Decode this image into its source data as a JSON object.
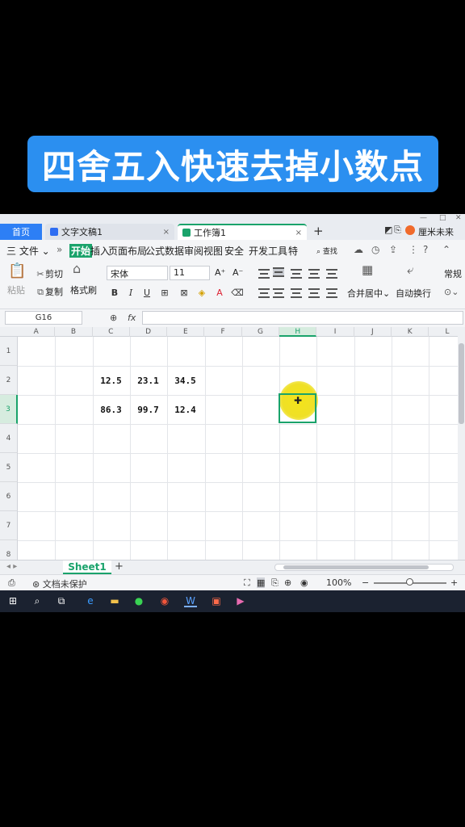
{
  "banner": {
    "title": "四舍五入快速去掉小数点"
  },
  "tabs": {
    "home": "首页",
    "doc": "文字文稿1",
    "sheet": "工作簿1",
    "close": "×",
    "plus": "+"
  },
  "user": {
    "name": "厘米未来"
  },
  "menu": {
    "file": "三 文件 ⌄",
    "more": "»",
    "items": [
      "开始",
      "插入",
      "页面布局",
      "公式",
      "数据",
      "审阅",
      "视图",
      "安全",
      "开发工具",
      "特"
    ],
    "search": "查找"
  },
  "ribbon": {
    "paste": "粘贴",
    "cut": "剪切",
    "copy": "复制",
    "format_painter": "格式刷",
    "font_name": "宋体",
    "font_size": "11",
    "grow": "A⁺",
    "shrink": "A⁻",
    "bold": "B",
    "italic": "I",
    "underline": "U",
    "merge": "合并居中",
    "wrap": "自动换行",
    "normal": "常规"
  },
  "formula_bar": {
    "cell_ref": "G16",
    "fx": "fx",
    "value": ""
  },
  "grid": {
    "columns": [
      "A",
      "B",
      "C",
      "D",
      "E",
      "F",
      "G",
      "H",
      "I",
      "J",
      "K",
      "L"
    ],
    "rows": [
      "1",
      "2",
      "3",
      "4",
      "5",
      "6",
      "7",
      "8"
    ],
    "selected_column": "H",
    "selected_row": "3",
    "values": {
      "r2": [
        "12.5",
        "23.1",
        "34.5"
      ],
      "r3": [
        "86.3",
        "99.7",
        "12.4"
      ]
    }
  },
  "sheet_tabs": {
    "active": "Sheet1",
    "add": "+"
  },
  "status": {
    "protect": "文档未保护",
    "zoom": "100%",
    "minus": "−",
    "plus": "+"
  },
  "colors": {
    "accent": "#1aa36b",
    "banner": "#2b8ff0",
    "home_tab": "#2d7ff5"
  }
}
